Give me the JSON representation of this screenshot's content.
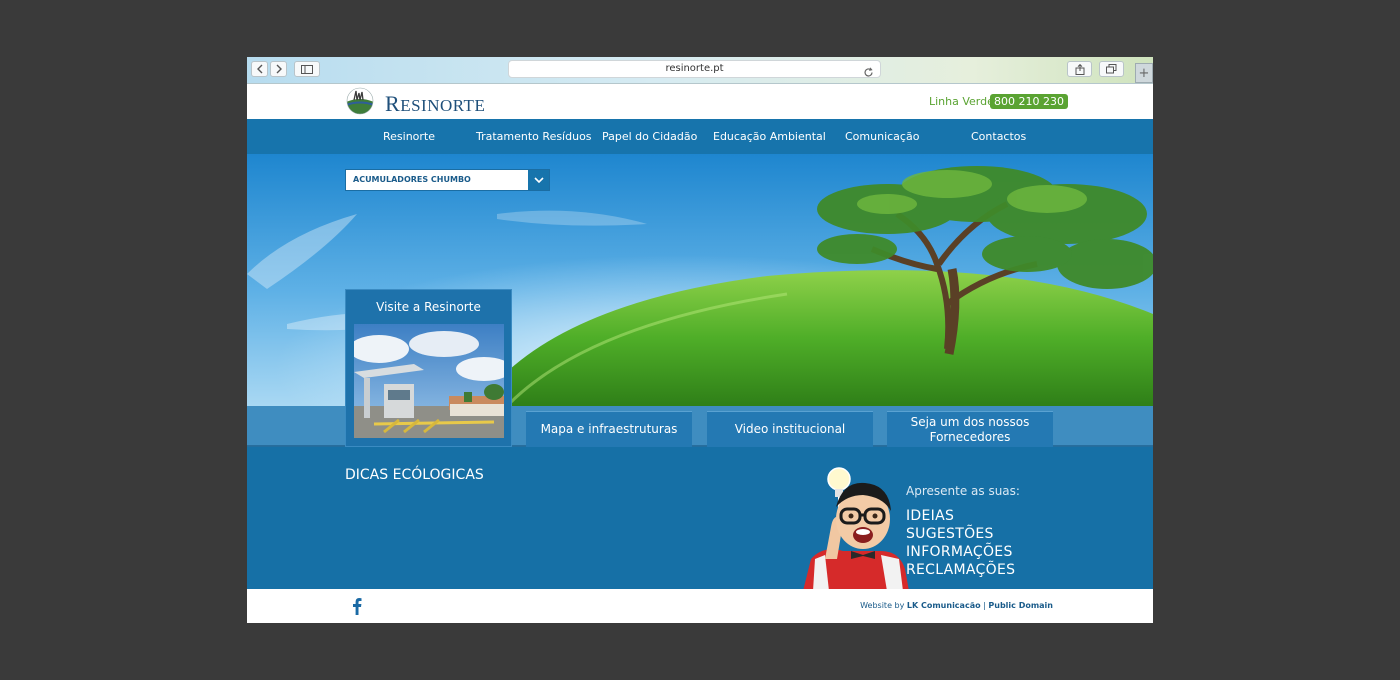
{
  "browser": {
    "url": "resinorte.pt"
  },
  "header": {
    "brand": "Resinorte",
    "hotline_label": "Linha Verde",
    "hotline_number": "800 210 230"
  },
  "nav": {
    "items": [
      {
        "label": "Resinorte"
      },
      {
        "label": "Tratamento Resíduos"
      },
      {
        "label": "Papel do Cidadão"
      },
      {
        "label": "Educação Ambiental"
      },
      {
        "label": "Comunicação"
      },
      {
        "label": "Contactos"
      }
    ]
  },
  "hero": {
    "select_value": "ACUMULADORES CHUMBO",
    "visit_title": "Visite a Resinorte",
    "buttons": [
      {
        "label": "Mapa e infraestruturas"
      },
      {
        "label": "Video institucional"
      },
      {
        "label": "Seja um dos nossos Fornecedores"
      }
    ]
  },
  "tips": {
    "title": "DICAS ECÓLOGICAS",
    "present": "Apresente as suas:",
    "options": [
      "IDEIAS",
      "SUGESTÕES",
      "INFORMAÇÕES",
      "RECLAMAÇÕES"
    ]
  },
  "footer": {
    "credit_prefix": "Website by",
    "credit_company": "LK Comunicacão",
    "separator": "|",
    "credit_domain": "Public Domain"
  },
  "colors": {
    "nav_blue": "#1774ac",
    "green_accent": "#5aa332",
    "section_blue": "#1670a6"
  },
  "icons": {
    "back": "chevron-left-icon",
    "forward": "chevron-right-icon",
    "sidebar": "sidebar-icon",
    "reload": "reload-icon",
    "share": "share-icon",
    "tabs": "tabs-icon",
    "newtab": "plus-icon",
    "dropdown": "chevron-down-icon",
    "facebook": "facebook-icon"
  }
}
